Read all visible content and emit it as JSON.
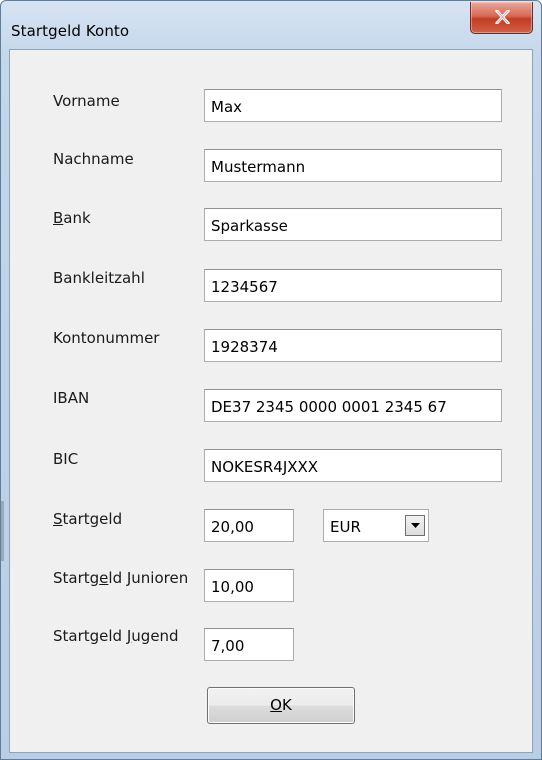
{
  "window": {
    "title": "Startgeld Konto"
  },
  "fields": {
    "vorname": {
      "label": "Vorname",
      "value": "Max"
    },
    "nachname": {
      "label": "Nachname",
      "value": "Mustermann"
    },
    "bank": {
      "label_first": "B",
      "label_rest": "ank",
      "value": "Sparkasse"
    },
    "blz": {
      "label": "Bankleitzahl",
      "value": "1234567"
    },
    "konto": {
      "label": "Kontonummer",
      "value": "1928374"
    },
    "iban": {
      "label": "IBAN",
      "value": "DE37 2345 0000 0001 2345 67"
    },
    "bic": {
      "label": "BIC",
      "value": "NOKESR4JXXX"
    },
    "startgeld": {
      "label_first": "S",
      "label_rest": "tartgeld",
      "value": "20,00"
    },
    "currency": {
      "selected": "EUR"
    },
    "junioren": {
      "label_pre": "Startg",
      "label_ul": "e",
      "label_post": "ld Junioren",
      "value": "10,00"
    },
    "jugend": {
      "label_pre": "Startgeld ",
      "label_ul": "J",
      "label_post": "ugend",
      "value": "7,00"
    }
  },
  "buttons": {
    "ok_ul": "O",
    "ok_rest": "K"
  },
  "icons": {
    "close": "close-icon",
    "dropdown": "chevron-down-icon"
  },
  "colors": {
    "close_button": "#c23c22",
    "dialog_bg": "#f0f0f0"
  }
}
